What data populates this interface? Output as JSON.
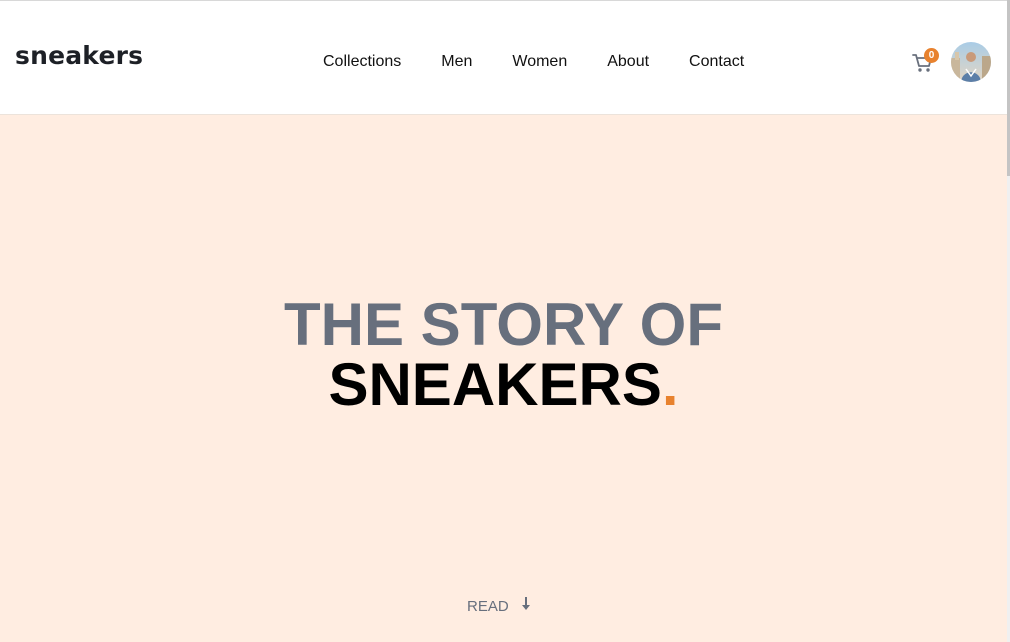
{
  "brand": {
    "logo": "sneakers"
  },
  "nav": {
    "items": [
      {
        "label": "Collections"
      },
      {
        "label": "Men"
      },
      {
        "label": "Women"
      },
      {
        "label": "About"
      },
      {
        "label": "Contact"
      }
    ]
  },
  "cart": {
    "count": "0",
    "icon": "cart-icon"
  },
  "user": {
    "avatar_icon": "avatar"
  },
  "hero": {
    "title_line1": "THE STORY OF",
    "title_line2": "SNEAKERS",
    "title_accent": ".",
    "read_label": "READ",
    "read_icon": "arrow-down-icon"
  },
  "colors": {
    "accent": "#e8822e",
    "hero_bg": "#ffede1",
    "muted_text": "#676f7d",
    "dark_text": "#1d2026"
  }
}
